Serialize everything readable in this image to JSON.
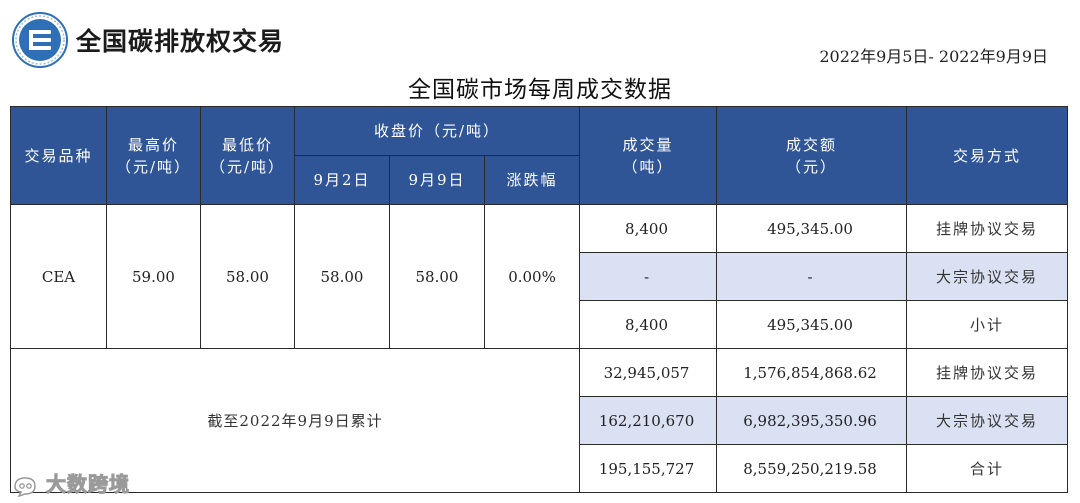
{
  "header": {
    "brand": "全国碳排放权交易",
    "date_range": "2022年9月5日- 2022年9月9日",
    "title": "全国碳市场每周成交数据"
  },
  "colors": {
    "header_bg": "#2f5597",
    "row_shade": "#d9e1f2",
    "logo_blue": "#2e6fb5"
  },
  "table": {
    "headers": {
      "product": "交易品种",
      "high_line1": "最高价",
      "high_line2": "（元/吨）",
      "low_line1": "最低价",
      "low_line2": "（元/吨）",
      "close_group": "收盘价（元/吨）",
      "close_d1": "9月2日",
      "close_d2": "9月9日",
      "change": "涨跌幅",
      "volume_line1": "成交量",
      "volume_line2": "（吨）",
      "amount_line1": "成交额",
      "amount_line2": "（元）",
      "method": "交易方式"
    },
    "weekly": {
      "product": "CEA",
      "high": "59.00",
      "low": "58.00",
      "close_d1": "58.00",
      "close_d2": "58.00",
      "change": "0.00%",
      "rows": [
        {
          "volume": "8,400",
          "amount": "495,345.00",
          "method": "挂牌协议交易"
        },
        {
          "volume": "-",
          "amount": "-",
          "method": "大宗协议交易"
        },
        {
          "volume": "8,400",
          "amount": "495,345.00",
          "method": "小计"
        }
      ]
    },
    "cumulative": {
      "label": "截至2022年9月9日累计",
      "rows": [
        {
          "volume": "32,945,057",
          "amount": "1,576,854,868.62",
          "method": "挂牌协议交易"
        },
        {
          "volume": "162,210,670",
          "amount": "6,982,395,350.96",
          "method": "大宗协议交易"
        },
        {
          "volume": "195,155,727",
          "amount": "8,559,250,219.58",
          "method": "合计"
        }
      ]
    }
  },
  "watermark": {
    "text": "大数跨境",
    "icon": "eye-speech-icon"
  }
}
